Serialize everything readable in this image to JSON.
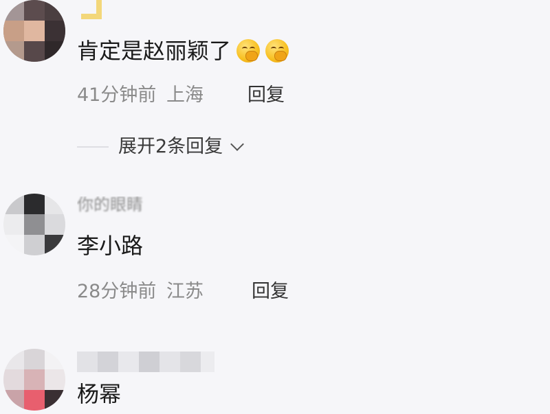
{
  "comments": [
    {
      "text": "肯定是赵丽颖了",
      "emojis": [
        "face-with-hand-over-mouth",
        "face-with-hand-over-mouth"
      ],
      "time": "41分钟前",
      "location": "上海",
      "reply_label": "回复",
      "expand_label": "展开2条回复"
    },
    {
      "username": "你的眼睛",
      "text": "李小路",
      "time": "28分钟前",
      "location": "江苏",
      "reply_label": "回复"
    },
    {
      "text": "杨幂"
    }
  ],
  "colors": {
    "background": "#f6f6f9",
    "text": "#1a1a1a",
    "meta": "#8a8a8a"
  }
}
